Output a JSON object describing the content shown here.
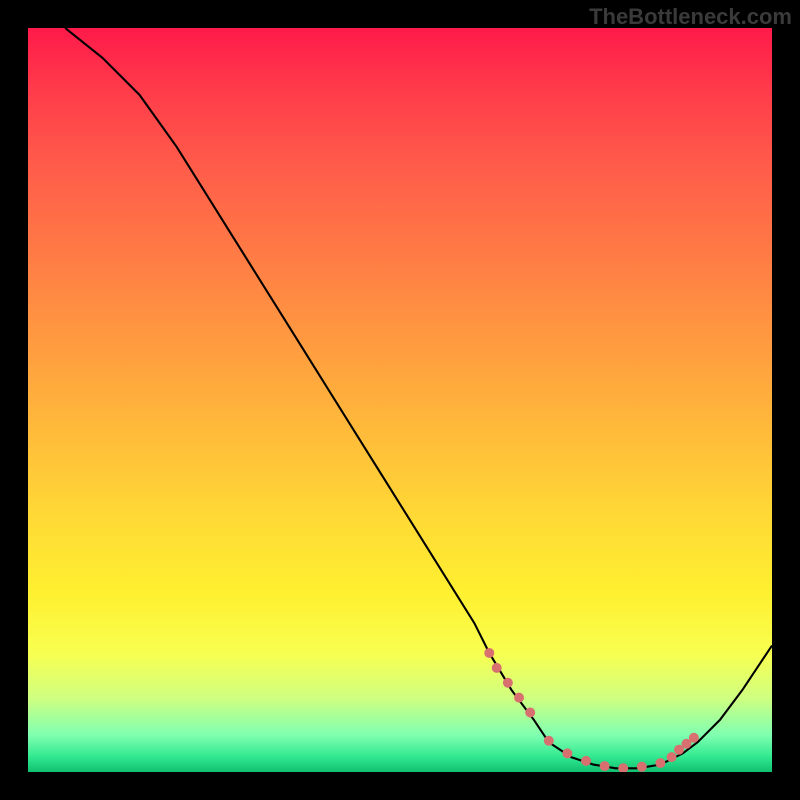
{
  "watermark": "TheBottleneck.com",
  "chart_data": {
    "type": "line",
    "title": "",
    "xlabel": "",
    "ylabel": "",
    "xlim": [
      0,
      100
    ],
    "ylim": [
      0,
      100
    ],
    "series": [
      {
        "name": "curve",
        "x": [
          5,
          10,
          15,
          20,
          25,
          30,
          35,
          40,
          45,
          50,
          55,
          60,
          62,
          65,
          68,
          70,
          73,
          76,
          79,
          82,
          85,
          88,
          90,
          93,
          96,
          100
        ],
        "y": [
          100,
          96,
          91,
          84,
          76,
          68,
          60,
          52,
          44,
          36,
          28,
          20,
          16,
          11,
          7,
          4,
          2,
          1,
          0.5,
          0.5,
          1,
          2.5,
          4,
          7,
          11,
          17
        ]
      }
    ],
    "highlight_dots": {
      "x": [
        62,
        63,
        64.5,
        66,
        67.5,
        70,
        72.5,
        75,
        77.5,
        80,
        82.5,
        85,
        86.5,
        87.5,
        88.5,
        89.5
      ],
      "y": [
        16,
        14,
        12,
        10,
        8,
        4.2,
        2.5,
        1.5,
        0.8,
        0.5,
        0.7,
        1.2,
        2,
        3,
        3.8,
        4.6
      ],
      "color": "#d97070",
      "radius": 5
    },
    "gradient_stops": [
      {
        "pos": 0,
        "color": "#ff1a4a"
      },
      {
        "pos": 18,
        "color": "#ff5a4a"
      },
      {
        "pos": 42,
        "color": "#ff9a40"
      },
      {
        "pos": 66,
        "color": "#ffda35"
      },
      {
        "pos": 84,
        "color": "#f8ff50"
      },
      {
        "pos": 95,
        "color": "#80ffb0"
      },
      {
        "pos": 100,
        "color": "#10c070"
      }
    ]
  }
}
